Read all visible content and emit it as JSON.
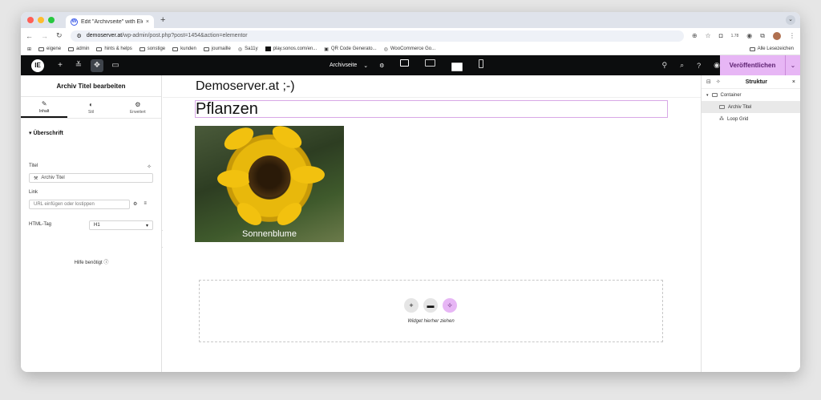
{
  "browser": {
    "tab_title": "Edit \"Archivseite\" with Elem...",
    "tab_close": "×",
    "new_tab": "+",
    "url_host": "demoserver.at",
    "url_path": "/wp-admin/post.php?post=1454&action=elementor",
    "extension_badge": "1.78",
    "bookmarks": [
      "eigene",
      "admin",
      "hints & helps",
      "sonstige",
      "kunden",
      "journaille",
      "Sa11y",
      "play.sonos.com/en...",
      "QR Code Generato...",
      "WooCommerce Go..."
    ],
    "all_bookmarks": "Alle Lesezeichen"
  },
  "topbar": {
    "page_selector": "Archivseite",
    "publish_label": "Veröffentlichen"
  },
  "left_panel": {
    "header": "Archiv Titel bearbeiten",
    "tabs": [
      {
        "label": "Inhalt",
        "icon": "✎"
      },
      {
        "label": "Stil",
        "icon": "◐"
      },
      {
        "label": "Erweitert",
        "icon": "⚙"
      }
    ],
    "section": "Überschrift",
    "title_label": "Titel",
    "title_value": "Archiv Titel",
    "link_label": "Link",
    "link_placeholder": "URL einfügen oder lostippen",
    "html_tag_label": "HTML-Tag",
    "html_tag_value": "H1",
    "help": "Hilfe benötigt"
  },
  "canvas": {
    "site_title": "Demoserver.at ;-)",
    "archive_title": "Pflanzen",
    "product_caption": "Sonnenblume",
    "dropzone_text": "Widget hierher ziehen"
  },
  "structure_panel": {
    "title": "Struktur",
    "close": "×",
    "items": [
      {
        "label": "Container"
      },
      {
        "label": "Archiv Titel"
      },
      {
        "label": "Loop Grid"
      }
    ]
  },
  "colors": {
    "accent": "#e7b6f5",
    "topbar": "#0c0d0e"
  }
}
